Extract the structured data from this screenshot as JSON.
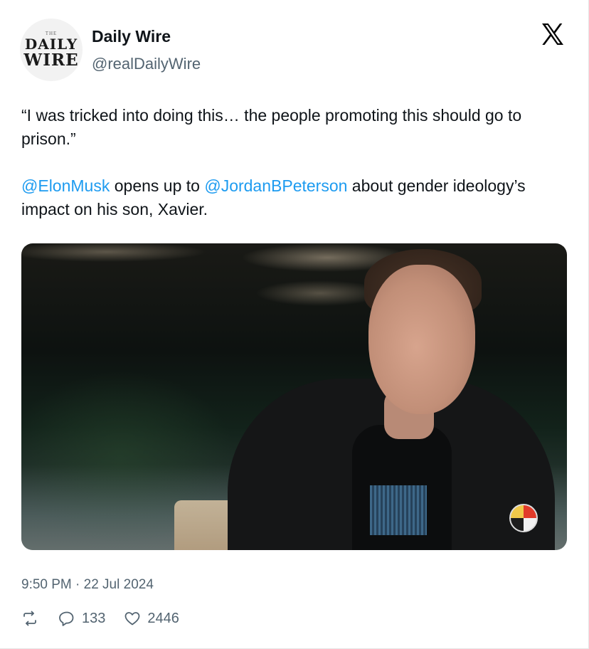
{
  "author": {
    "avatar_text": {
      "top": "THE",
      "line1": "DAILY",
      "line2": "WIRE"
    },
    "name": "Daily Wire",
    "handle": "@realDailyWire"
  },
  "header": {
    "logo_icon": "x-logo-icon"
  },
  "tweet": {
    "line1": "“I was tricked into doing this… the people promoting this should go to prison.”",
    "mention1": "@ElonMusk",
    "mid_text": " opens up to ",
    "mention2": "@JordanBPeterson",
    "tail_text": " about gender ideology’s impact on his son, Xavier."
  },
  "media": {
    "kind": "video-still"
  },
  "timestamp": "9:50 PM · 22 Jul 2024",
  "actions": {
    "retweet_icon": "retweet-icon",
    "reply_icon": "reply-icon",
    "reply_count": "133",
    "like_icon": "heart-icon",
    "like_count": "2446"
  },
  "colors": {
    "mention": "#1d9bf0",
    "secondary": "#536471",
    "text": "#0f1419"
  }
}
